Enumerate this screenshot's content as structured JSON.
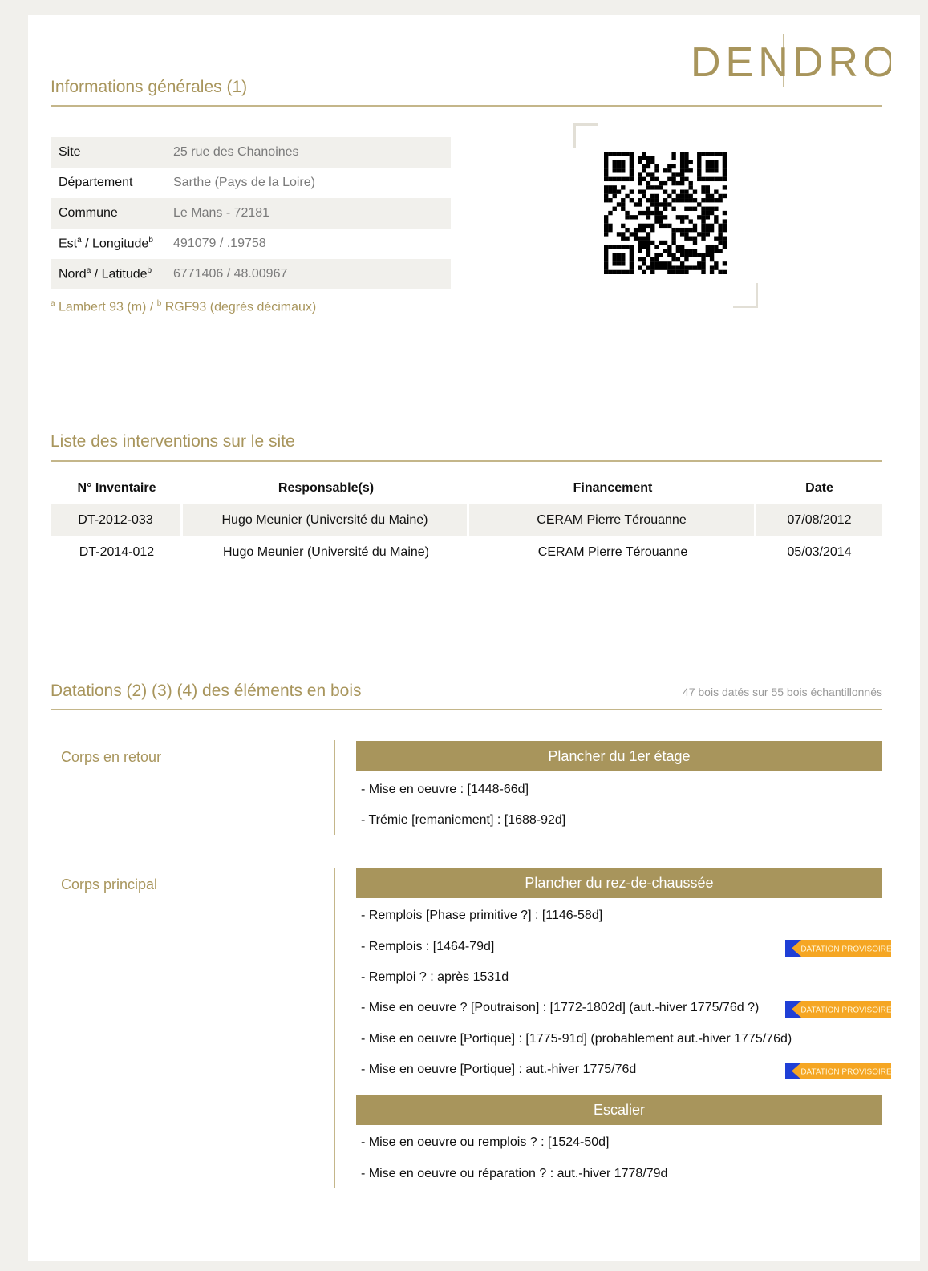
{
  "logo": {
    "text": "DENDROTECH"
  },
  "general": {
    "title": "Informations générales (1)",
    "rows": [
      {
        "key": "Site",
        "value": "25 rue des Chanoines"
      },
      {
        "key": "Département",
        "value": "Sarthe (Pays de la Loire)"
      },
      {
        "key": "Commune",
        "value": "Le Mans - 72181"
      },
      {
        "key_a": "Est",
        "key_b": " / Longitude",
        "sup_a": "a",
        "sup_b": "b",
        "value": "491079 / .19758"
      },
      {
        "key_a": "Nord",
        "key_b": " / Latitude",
        "sup_a": "a",
        "sup_b": "b",
        "value": "6771406 / 48.00967"
      }
    ],
    "footnote": {
      "sup_a": "a",
      "text_a": " Lambert 93 (m) / ",
      "sup_b": "b",
      "text_b": " RGF93 (degrés décimaux)"
    }
  },
  "interventions": {
    "title": "Liste des interventions sur le site",
    "headers": [
      "N° Inventaire",
      "Responsable(s)",
      "Financement",
      "Date"
    ],
    "rows": [
      [
        "DT-2012-033",
        "Hugo Meunier (Université du Maine)",
        "CERAM Pierre Térouanne",
        "07/08/2012"
      ],
      [
        "DT-2014-012",
        "Hugo Meunier (Université du Maine)",
        "CERAM Pierre Térouanne",
        "05/03/2014"
      ]
    ]
  },
  "datations": {
    "title": "Datations (2) (3) (4) des éléments en bois",
    "count": "47 bois datés sur 55 bois échantillonnés",
    "badge_text": "DATATION PROVISOIRE",
    "groups": [
      {
        "label": "Corps en retour",
        "sections": [
          {
            "title": "Plancher du 1er étage",
            "items": [
              "- Mise en oeuvre : [1448-66d]",
              "- Trémie [remaniement] : [1688-92d]"
            ]
          }
        ]
      },
      {
        "label": "Corps principal",
        "sections": [
          {
            "title": "Plancher du rez-de-chaussée",
            "items": [
              "- Remplois [Phase primitive ?] : [1146-58d]",
              "- Remplois : [1464-79d]",
              "- Remploi ? : après 1531d",
              "- Mise en oeuvre ? [Poutraison] : [1772-1802d] (aut.-hiver 1775/76d ?)",
              "- Mise en oeuvre [Portique] : [1775-91d] (probablement aut.-hiver 1775/76d)",
              "- Mise en oeuvre [Portique] : aut.-hiver 1775/76d"
            ]
          },
          {
            "title": "Escalier",
            "items": [
              "- Mise en oeuvre ou remplois ? : [1524-50d]",
              "- Mise en oeuvre ou réparation ? : aut.-hiver 1778/79d"
            ]
          }
        ]
      }
    ]
  },
  "colors": {
    "gold": "#a8955c",
    "shade": "#f1f0ec",
    "badge_orange": "#f5a623",
    "badge_blue": "#1f3fd6"
  }
}
